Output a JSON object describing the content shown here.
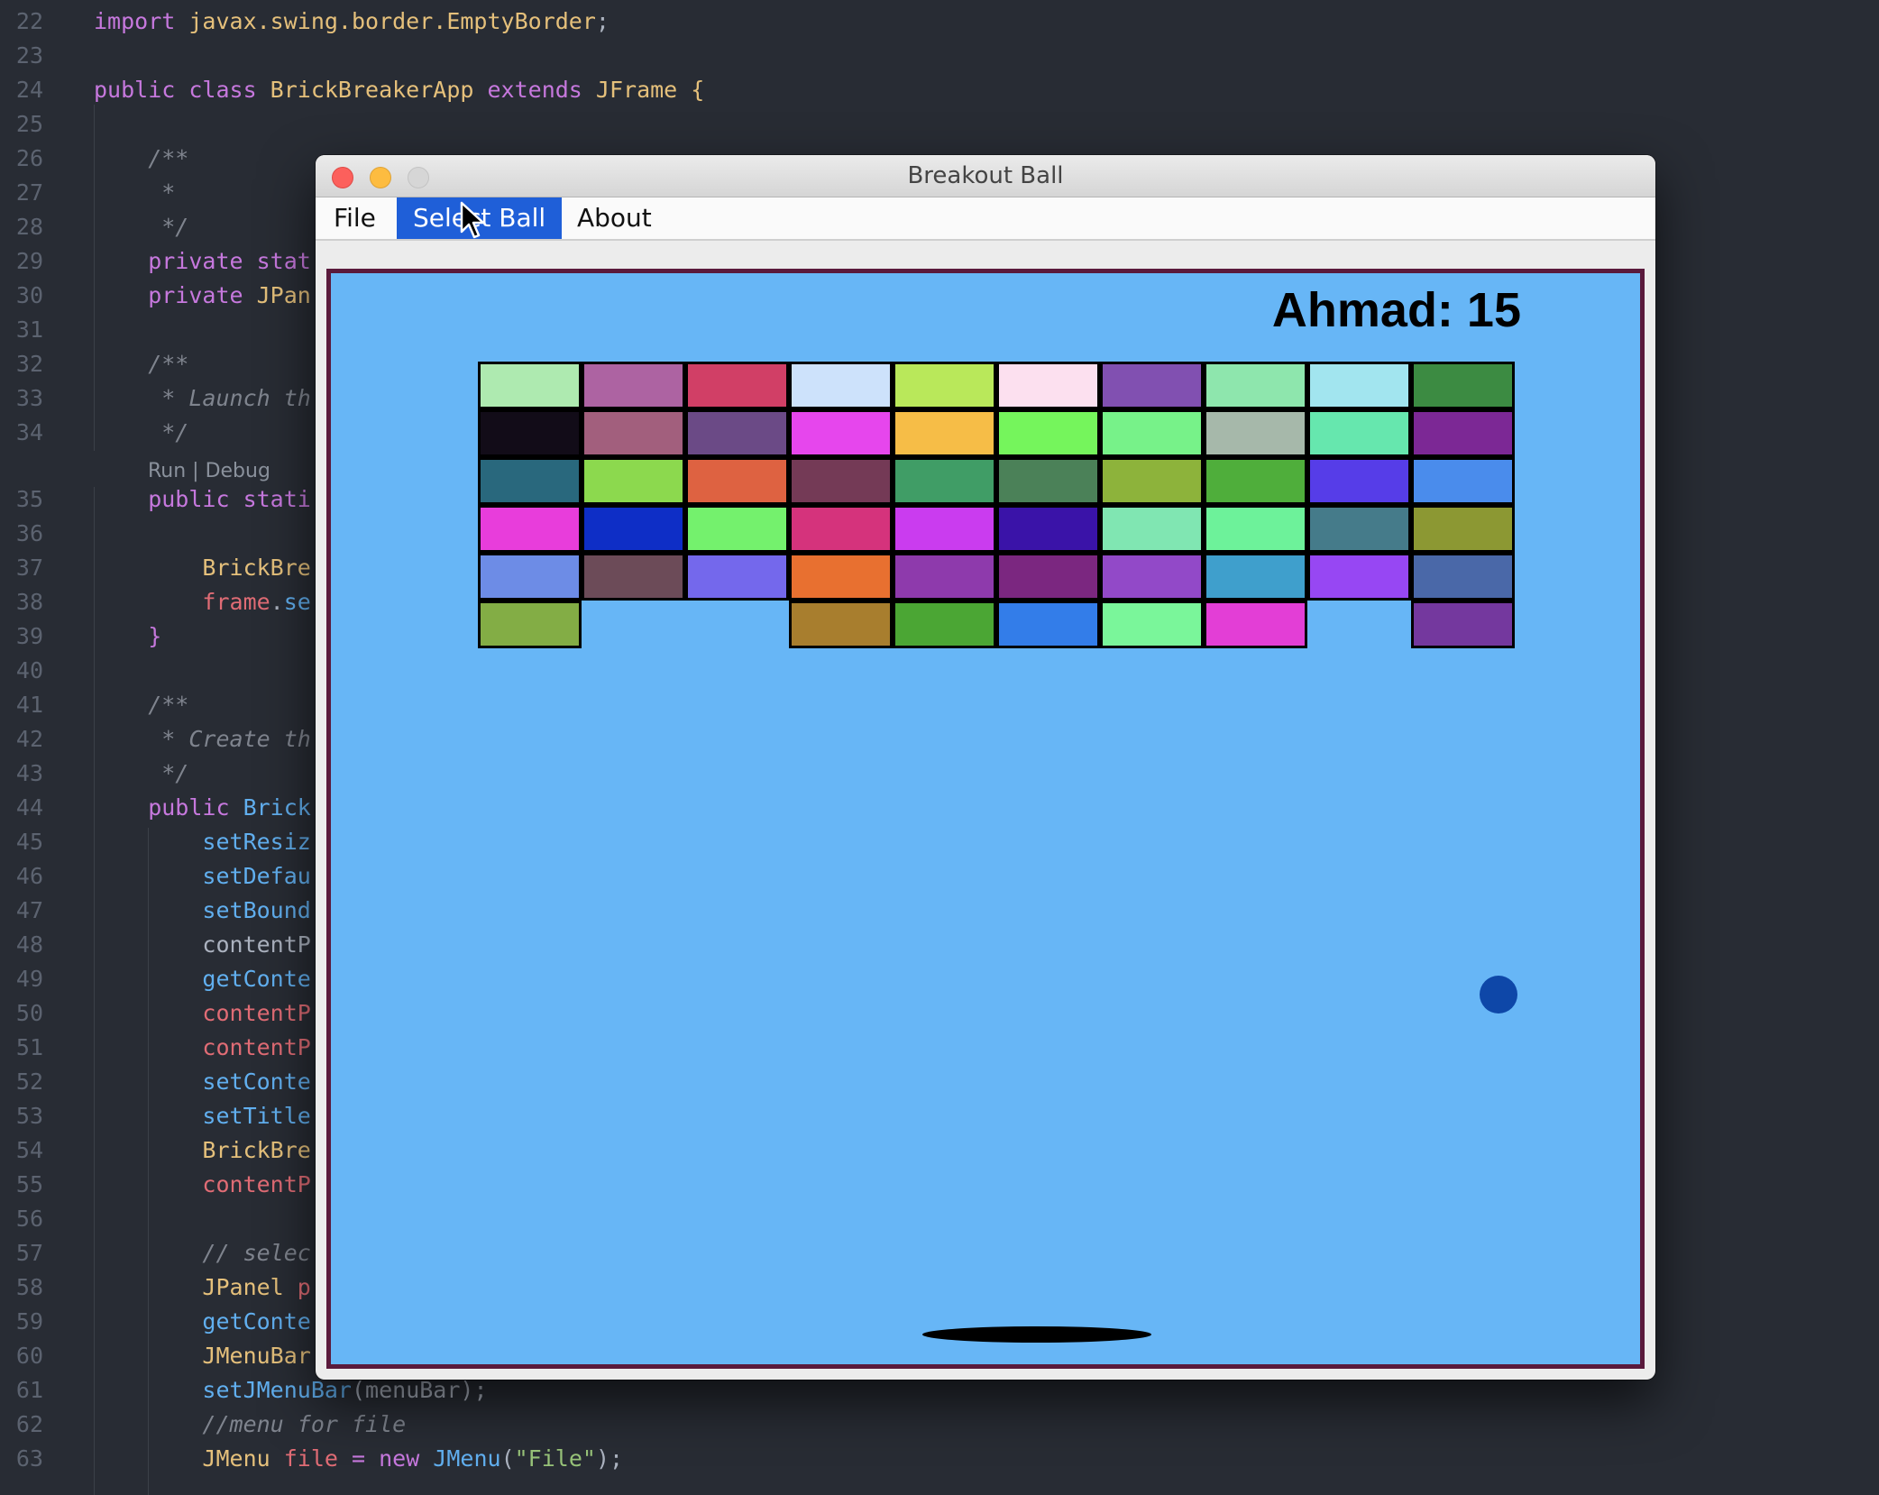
{
  "editor": {
    "lines": [
      {
        "n": "22",
        "tokens": [
          [
            "t-kw",
            "import "
          ],
          [
            "t-cls",
            "javax.swing.border.EmptyBorder"
          ],
          [
            "t-txt",
            ";"
          ]
        ]
      },
      {
        "n": "23",
        "tokens": []
      },
      {
        "n": "24",
        "tokens": [
          [
            "t-kw",
            "public class "
          ],
          [
            "t-cls",
            "BrickBreakerApp "
          ],
          [
            "t-kw",
            "extends "
          ],
          [
            "t-cls",
            "JFrame "
          ],
          [
            "t-cls",
            "{"
          ]
        ]
      },
      {
        "n": "25",
        "tokens": []
      },
      {
        "n": "26",
        "tokens": [
          [
            "t-com",
            "    /**"
          ]
        ]
      },
      {
        "n": "27",
        "tokens": [
          [
            "t-com",
            "     *"
          ]
        ]
      },
      {
        "n": "28",
        "tokens": [
          [
            "t-com",
            "     */"
          ]
        ]
      },
      {
        "n": "29",
        "tokens": [
          [
            "t-kw",
            "    private stat"
          ]
        ]
      },
      {
        "n": "30",
        "tokens": [
          [
            "t-kw",
            "    private "
          ],
          [
            "t-cls",
            "JPan"
          ]
        ]
      },
      {
        "n": "31",
        "tokens": []
      },
      {
        "n": "32",
        "tokens": [
          [
            "t-com",
            "    /**"
          ]
        ]
      },
      {
        "n": "33",
        "tokens": [
          [
            "t-com",
            "     * Launch th"
          ]
        ]
      },
      {
        "n": "34",
        "tokens": [
          [
            "t-com",
            "     */"
          ]
        ]
      },
      {
        "n": "35",
        "tokens": [
          [
            "t-kw",
            "    public stati"
          ]
        ]
      },
      {
        "n": "36",
        "tokens": []
      },
      {
        "n": "37",
        "tokens": [
          [
            "t-cls",
            "        BrickBre"
          ]
        ]
      },
      {
        "n": "38",
        "tokens": [
          [
            "t-var",
            "        frame"
          ],
          [
            "t-txt",
            "."
          ],
          [
            "t-fn",
            "se"
          ]
        ]
      },
      {
        "n": "39",
        "tokens": [
          [
            "t-kw",
            "    }"
          ]
        ]
      },
      {
        "n": "40",
        "tokens": []
      },
      {
        "n": "41",
        "tokens": [
          [
            "t-com",
            "    /**"
          ]
        ]
      },
      {
        "n": "42",
        "tokens": [
          [
            "t-com",
            "     * Create th"
          ]
        ]
      },
      {
        "n": "43",
        "tokens": [
          [
            "t-com",
            "     */"
          ]
        ]
      },
      {
        "n": "44",
        "tokens": [
          [
            "t-kw",
            "    public "
          ],
          [
            "t-fn",
            "Brick"
          ]
        ]
      },
      {
        "n": "45",
        "tokens": [
          [
            "t-fn",
            "        setResiz"
          ]
        ]
      },
      {
        "n": "46",
        "tokens": [
          [
            "t-fn",
            "        setDefau"
          ]
        ]
      },
      {
        "n": "47",
        "tokens": [
          [
            "t-fn",
            "        setBound"
          ]
        ]
      },
      {
        "n": "48",
        "tokens": [
          [
            "t-txt",
            "        contentP"
          ]
        ]
      },
      {
        "n": "49",
        "tokens": [
          [
            "t-fn",
            "        getConte"
          ]
        ]
      },
      {
        "n": "50",
        "tokens": [
          [
            "t-var",
            "        contentP"
          ]
        ]
      },
      {
        "n": "51",
        "tokens": [
          [
            "t-var",
            "        contentP"
          ]
        ]
      },
      {
        "n": "52",
        "tokens": [
          [
            "t-fn",
            "        setConte"
          ]
        ]
      },
      {
        "n": "53",
        "tokens": [
          [
            "t-fn",
            "        setTitle"
          ]
        ]
      },
      {
        "n": "54",
        "tokens": [
          [
            "t-cls",
            "        BrickBre"
          ]
        ]
      },
      {
        "n": "55",
        "tokens": [
          [
            "t-var",
            "        contentP"
          ]
        ]
      },
      {
        "n": "56",
        "tokens": []
      },
      {
        "n": "57",
        "tokens": [
          [
            "t-com",
            "        // selec"
          ]
        ]
      },
      {
        "n": "58",
        "tokens": [
          [
            "t-cls",
            "        JPanel "
          ],
          [
            "t-var",
            "p"
          ]
        ]
      },
      {
        "n": "59",
        "tokens": [
          [
            "t-fn",
            "        getConte"
          ]
        ]
      },
      {
        "n": "60",
        "tokens": [
          [
            "t-cls",
            "        JMenuBar"
          ]
        ]
      },
      {
        "n": "61",
        "tokens": [
          [
            "t-fn",
            "        setJMenuBar"
          ],
          [
            "t-txt",
            "(menuBar);"
          ]
        ]
      },
      {
        "n": "62",
        "tokens": [
          [
            "t-com",
            "        //menu for file"
          ]
        ]
      },
      {
        "n": "63",
        "tokens": [
          [
            "t-cls",
            "        JMenu "
          ],
          [
            "t-var",
            "file "
          ],
          [
            "t-kw",
            "= new "
          ],
          [
            "t-fn",
            "JMenu"
          ],
          [
            "t-txt",
            "("
          ],
          [
            "t-str",
            "\"File\""
          ],
          [
            "t-txt",
            ");"
          ]
        ]
      }
    ],
    "codelens": "Run | Debug"
  },
  "window": {
    "title": "Breakout Ball",
    "menus": {
      "file": "File",
      "select_ball": "Select Ball",
      "about": "About"
    }
  },
  "game": {
    "score_text": "Ahmad: 15",
    "colors": {
      "background": "#67b6f6",
      "border": "#5a1a3c",
      "ball": "#0e47a8",
      "paddle": "#000000"
    },
    "bricks": [
      [
        "#aeeab0",
        "#ad63a2",
        "#d13f66",
        "#cde2fb",
        "#b9e85a",
        "#fce0ef",
        "#8150b1",
        "#8ee6ad",
        "#a2e5ef",
        "#3c8b42"
      ],
      [
        "#120c18",
        "#a25f7d",
        "#6b4a86",
        "#e646ed",
        "#f6bd47",
        "#75f55c",
        "#77f289",
        "#a6b8aa",
        "#66e7ae",
        "#7c2895"
      ],
      [
        "#29687d",
        "#8cd94e",
        "#de6241",
        "#743a56",
        "#409d66",
        "#4b8158",
        "#8db33b",
        "#4fae3b",
        "#563de8",
        "#4a8cec"
      ],
      [
        "#e83ddb",
        "#0e2ec6",
        "#74f16d",
        "#d5337c",
        "#ca3cef",
        "#3a13a8",
        "#80e6b2",
        "#6df29a",
        "#457b8a",
        "#8c9833"
      ],
      [
        "#6d8ce6",
        "#6c4b58",
        "#7468ec",
        "#e87030",
        "#8e3aac",
        "#7b2780",
        "#9249c8",
        "#3f9fcc",
        "#9747f3",
        "#4a68a8"
      ],
      [
        "#83ad45",
        null,
        null,
        "#a87e2e",
        "#4ba634",
        "#337de9",
        "#7af69a",
        "#e33ed6",
        null,
        "#74389e"
      ]
    ]
  }
}
